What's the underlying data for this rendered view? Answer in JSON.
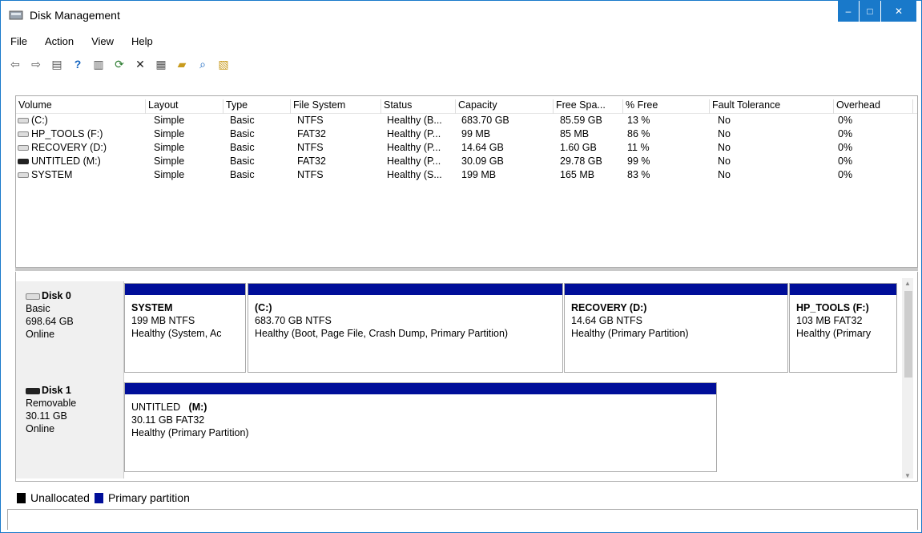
{
  "window": {
    "title": "Disk Management",
    "minimize": "–",
    "maximize": "□",
    "close": "✕"
  },
  "menu": [
    {
      "label": "File"
    },
    {
      "label": "Action"
    },
    {
      "label": "View"
    },
    {
      "label": "Help"
    }
  ],
  "toolbar": [
    "back-icon",
    "forward-icon",
    "show-hide-console-tree-icon",
    "help-icon",
    "properties-list-icon",
    "refresh-icon",
    "delete-icon",
    "properties-icon",
    "open-icon",
    "explore-icon",
    "settings-icon"
  ],
  "columns": [
    "Volume",
    "Layout",
    "Type",
    "File System",
    "Status",
    "Capacity",
    "Free Spa...",
    "% Free",
    "Fault Tolerance",
    "Overhead"
  ],
  "volumes": [
    {
      "volume": "(C:)",
      "layout": "Simple",
      "type": "Basic",
      "fs": "NTFS",
      "status": "Healthy (B...",
      "capacity": "683.70 GB",
      "free": "85.59 GB",
      "pct": "13 %",
      "fault": "No",
      "overhead": "0%",
      "icon": "drive"
    },
    {
      "volume": "HP_TOOLS (F:)",
      "layout": "Simple",
      "type": "Basic",
      "fs": "FAT32",
      "status": "Healthy (P...",
      "capacity": "99 MB",
      "free": "85 MB",
      "pct": "86 %",
      "fault": "No",
      "overhead": "0%",
      "icon": "drive"
    },
    {
      "volume": "RECOVERY (D:)",
      "layout": "Simple",
      "type": "Basic",
      "fs": "NTFS",
      "status": "Healthy (P...",
      "capacity": "14.64 GB",
      "free": "1.60 GB",
      "pct": "11 %",
      "fault": "No",
      "overhead": "0%",
      "icon": "drive"
    },
    {
      "volume": "UNTITLED  (M:)",
      "layout": "Simple",
      "type": "Basic",
      "fs": "FAT32",
      "status": "Healthy (P...",
      "capacity": "30.09 GB",
      "free": "29.78 GB",
      "pct": "99 %",
      "fault": "No",
      "overhead": "0%",
      "icon": "removable-drive"
    },
    {
      "volume": "SYSTEM",
      "layout": "Simple",
      "type": "Basic",
      "fs": "NTFS",
      "status": "Healthy (S...",
      "capacity": "199 MB",
      "free": "165 MB",
      "pct": "83 %",
      "fault": "No",
      "overhead": "0%",
      "icon": "drive"
    }
  ],
  "disks": [
    {
      "name": "Disk 0",
      "kind": "Basic",
      "size": "698.64 GB",
      "state": "Online",
      "partitions": [
        {
          "name": "SYSTEM",
          "detail": "199 MB NTFS",
          "health": "Healthy (System, Ac"
        },
        {
          "name": "(C:)",
          "detail": "683.70 GB NTFS",
          "health": "Healthy (Boot, Page File, Crash Dump, Primary Partition)"
        },
        {
          "name": "RECOVERY  (D:)",
          "detail": "14.64 GB NTFS",
          "health": "Healthy (Primary Partition)"
        },
        {
          "name": "HP_TOOLS  (F:)",
          "detail": "103 MB FAT32",
          "health": "Healthy (Primary"
        }
      ]
    },
    {
      "name": "Disk 1",
      "kind": "Removable",
      "size": "30.11 GB",
      "state": "Online",
      "partitions": [
        {
          "name_plain": "UNTITLED",
          "name_bold": "(M:)",
          "detail": "30.11 GB FAT32",
          "health": "Healthy (Primary Partition)"
        }
      ]
    }
  ],
  "legend": [
    {
      "label": "Unallocated",
      "color": "#000000"
    },
    {
      "label": "Primary partition",
      "color": "#000e99"
    }
  ],
  "colors": {
    "title_accent": "#1979ca",
    "partition_bar": "#000e99"
  }
}
